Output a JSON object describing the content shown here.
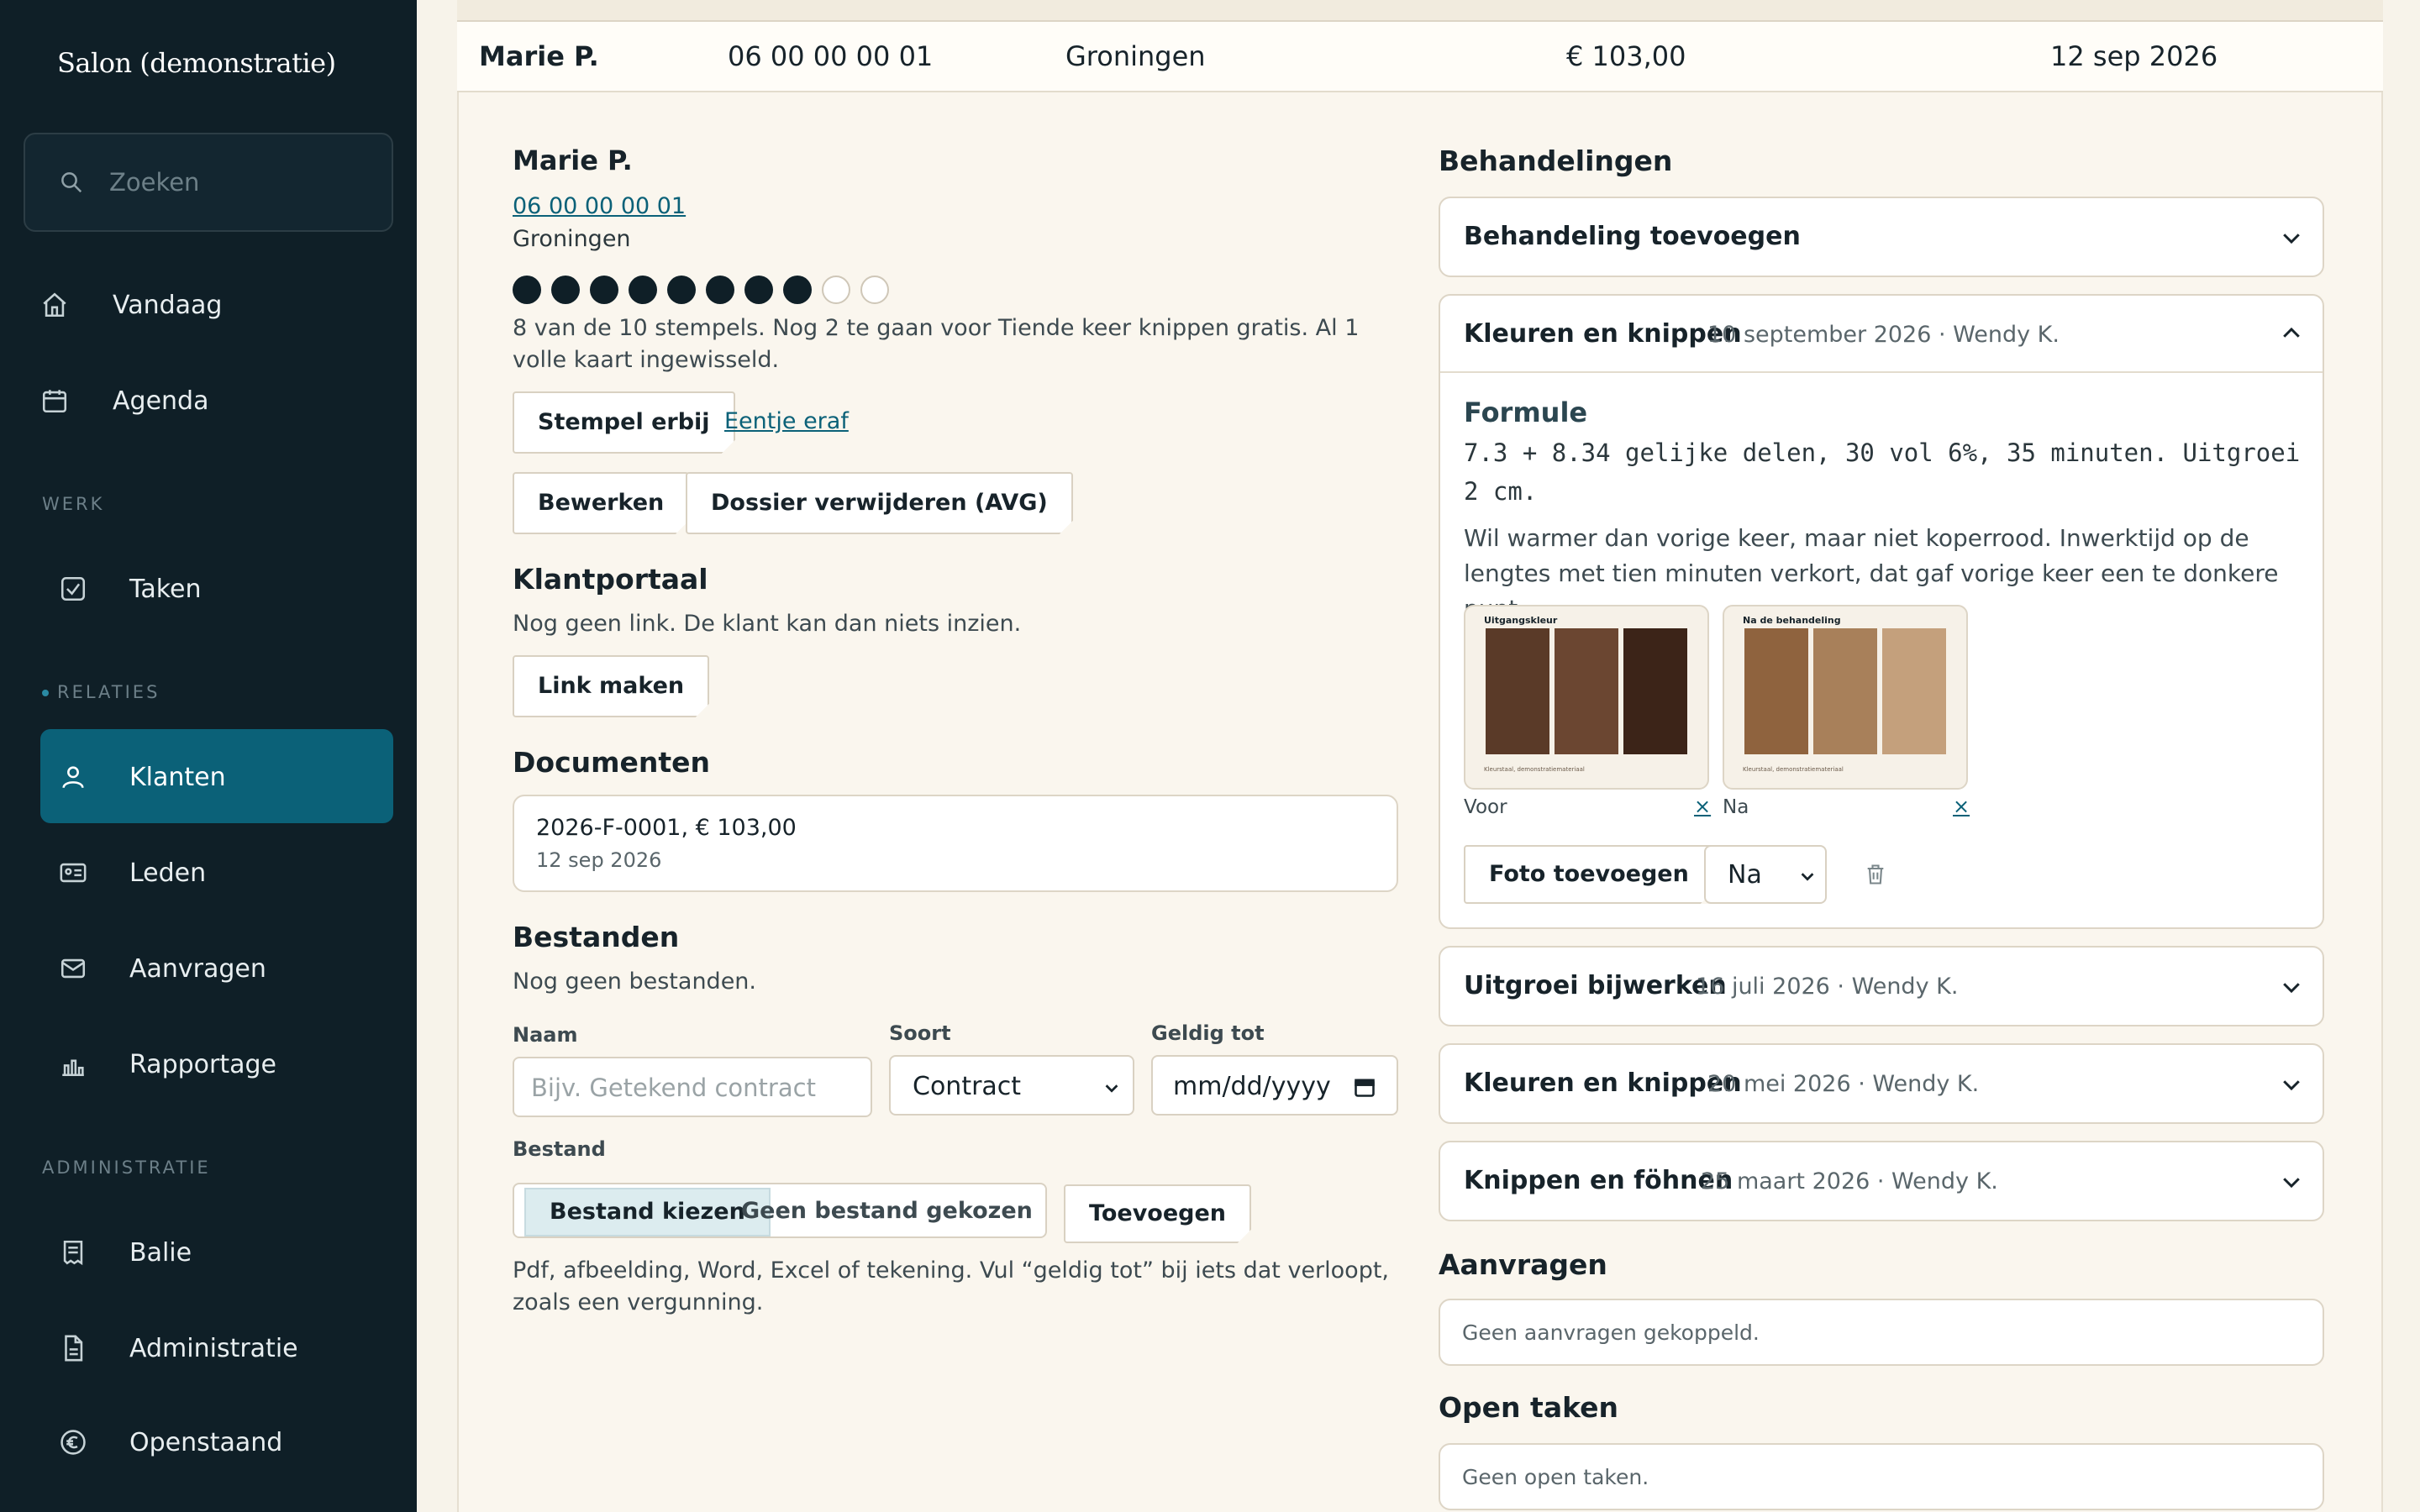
{
  "sidebar": {
    "brand": "Salon (demonstratie)",
    "search_placeholder": "Zoeken",
    "items_top": [
      {
        "label": "Vandaag",
        "icon": "home-icon"
      },
      {
        "label": "Agenda",
        "icon": "calendar-icon"
      }
    ],
    "section_werk": "WERK",
    "werk_items": [
      {
        "label": "Taken",
        "icon": "checkbox-icon"
      }
    ],
    "section_relaties": "RELATIES",
    "relaties_items": [
      {
        "label": "Klanten",
        "icon": "person-icon",
        "active": true
      },
      {
        "label": "Leden",
        "icon": "id-card-icon"
      },
      {
        "label": "Aanvragen",
        "icon": "mail-icon"
      },
      {
        "label": "Rapportage",
        "icon": "bar-chart-icon"
      }
    ],
    "section_admin": "ADMINISTRATIE",
    "admin_items": [
      {
        "label": "Balie",
        "icon": "receipt-icon"
      },
      {
        "label": "Administratie",
        "icon": "document-icon"
      },
      {
        "label": "Openstaand",
        "icon": "euro-icon"
      }
    ]
  },
  "summary": {
    "name": "Marie P.",
    "phone": "06 00 00 00 01",
    "city": "Groningen",
    "amount": "€ 103,00",
    "date": "12 sep 2026"
  },
  "client": {
    "name": "Marie P.",
    "phone": "06 00 00 00 01",
    "city": "Groningen",
    "stamps_filled": 8,
    "stamps_total": 10,
    "stamps_text": "8 van de 10 stempels. Nog 2 te gaan voor Tiende keer knippen gratis. Al 1 volle kaart ingewisseld.",
    "stamp_button": "Stempel erbij",
    "stamp_remove": "Eentje eraf",
    "edit_button": "Bewerken",
    "delete_button": "Dossier verwijderen (AVG)"
  },
  "portal": {
    "title": "Klantportaal",
    "text": "Nog geen link. De klant kan dan niets inzien.",
    "button": "Link maken"
  },
  "documents": {
    "title": "Documenten",
    "items": [
      {
        "title": "2026-F-0001, € 103,00",
        "date": "12 sep 2026"
      }
    ]
  },
  "files": {
    "title": "Bestanden",
    "empty": "Nog geen bestanden.",
    "name_label": "Naam",
    "name_placeholder": "Bijv. Getekend contract",
    "type_label": "Soort",
    "type_value": "Contract",
    "valid_label": "Geldig tot",
    "valid_placeholder": "mm/dd/yyyy",
    "file_label": "Bestand",
    "choose_button": "Bestand kiezen",
    "no_file": "Geen bestand gekozen",
    "add_button": "Toevoegen",
    "hint": "Pdf, afbeelding, Word, Excel of tekening. Vul “geldig tot” bij iets dat verloopt, zoals een vergunning."
  },
  "treatments": {
    "title": "Behandelingen",
    "add_label": "Behandeling toevoegen",
    "open": {
      "title": "Kleuren en knippen",
      "meta": "10 september 2026 · Wendy K.",
      "formula_label": "Formule",
      "formula_line1": "7.3 + 8.34 gelijke delen, 30 vol 6%, 35 minuten. Uitgroei",
      "formula_line2": "2 cm.",
      "note": "Wil warmer dan vorige keer, maar niet koperrood. Inwerktijd op de lengtes met tien minuten verkort, dat gaf vorige keer een te donkere punt.",
      "photos": [
        {
          "caption": "Uitgangskleur",
          "footer": "Kleurstaal, demonstratiemateriaal",
          "label": "Voor",
          "remove": "×",
          "colors": [
            "#5a3a28",
            "#6b4631",
            "#3c2418"
          ]
        },
        {
          "caption": "Na de behandeling",
          "footer": "Kleurstaal, demonstratiemateriaal",
          "label": "Na",
          "remove": "×",
          "colors": [
            "#8f633e",
            "#a8805a",
            "#c4a07c"
          ]
        }
      ],
      "add_photo": "Foto toevoegen",
      "select_value": "Na"
    },
    "history": [
      {
        "title": "Uitgroei bijwerken",
        "meta": "16 juli 2026 · Wendy K."
      },
      {
        "title": "Kleuren en knippen",
        "meta": "20 mei 2026 · Wendy K."
      },
      {
        "title": "Knippen en föhnen",
        "meta": "25 maart 2026 · Wendy K."
      }
    ]
  },
  "requests": {
    "title": "Aanvragen",
    "empty": "Geen aanvragen gekoppeld."
  },
  "tasks": {
    "title": "Open taken",
    "empty": "Geen open taken."
  },
  "colors": {
    "accent": "#0b6178",
    "sidebar": "#0f1f27",
    "background": "#f7f3ea"
  }
}
